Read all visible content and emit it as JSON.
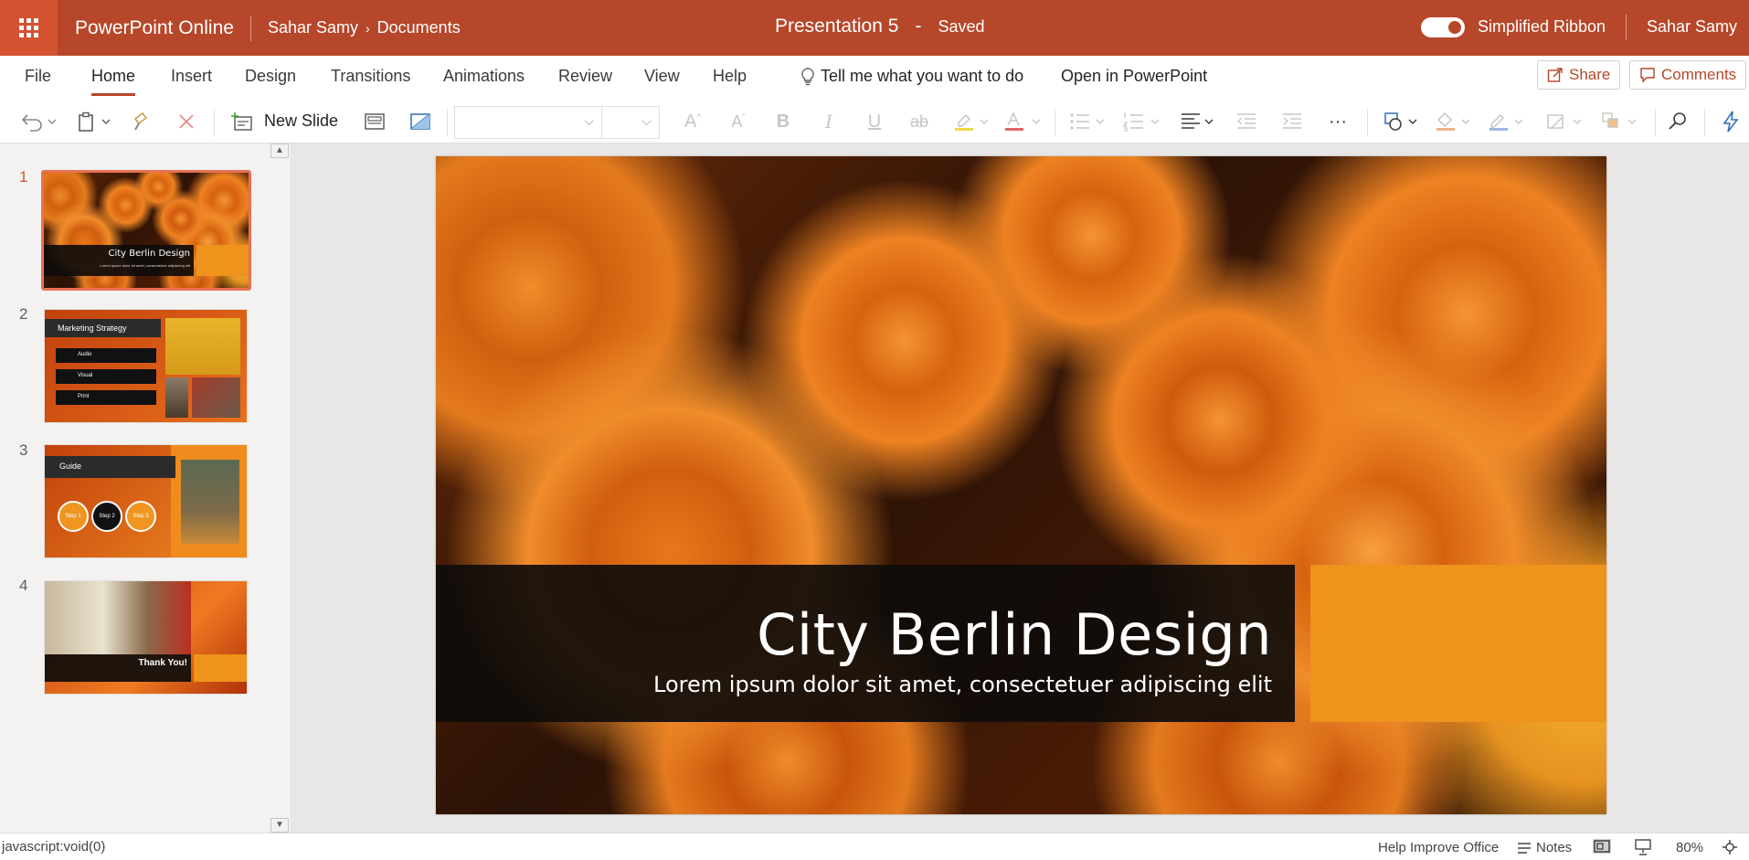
{
  "titlebar": {
    "app_name": "PowerPoint Online",
    "breadcrumb_user": "Sahar Samy",
    "breadcrumb_folder": "Documents",
    "doc_name": "Presentation 5",
    "doc_dash": "-",
    "doc_status": "Saved",
    "simplified_ribbon_label": "Simplified Ribbon",
    "simplified_ribbon_on": true,
    "user_name": "Sahar Samy",
    "accent_color": "#b7472a"
  },
  "tabs": {
    "file": "File",
    "home": "Home",
    "insert": "Insert",
    "design": "Design",
    "transitions": "Transitions",
    "animations": "Animations",
    "review": "Review",
    "view": "View",
    "help": "Help",
    "active": "Home",
    "tell_me": "Tell me what you want to do",
    "open_in_ppt": "Open in PowerPoint",
    "share": "Share",
    "comments": "Comments"
  },
  "toolbar": {
    "new_slide_label": "New Slide",
    "font_name_value": "",
    "font_size_value": ""
  },
  "thumbnails": [
    {
      "number": "1",
      "title": "City Berlin Design",
      "subtitle": "Lorem ipsum dolor sit amet, consectetuer adipiscing elit",
      "selected": true
    },
    {
      "number": "2",
      "title": "Marketing Strategy",
      "items": [
        "Audio",
        "Visual",
        "Print"
      ]
    },
    {
      "number": "3",
      "title": "Guide",
      "steps": [
        "Step 1",
        "Step 2",
        "Step 3"
      ]
    },
    {
      "number": "4",
      "title": "Thank You!"
    }
  ],
  "slide": {
    "title": "City Berlin Design",
    "subtitle": "Lorem ipsum dolor sit amet, consectetuer adipiscing elit",
    "accent_color": "#ee931b"
  },
  "statusbar": {
    "link_text": "javascript:void(0)",
    "help_improve": "Help Improve Office",
    "notes": "Notes",
    "zoom": "80%"
  }
}
